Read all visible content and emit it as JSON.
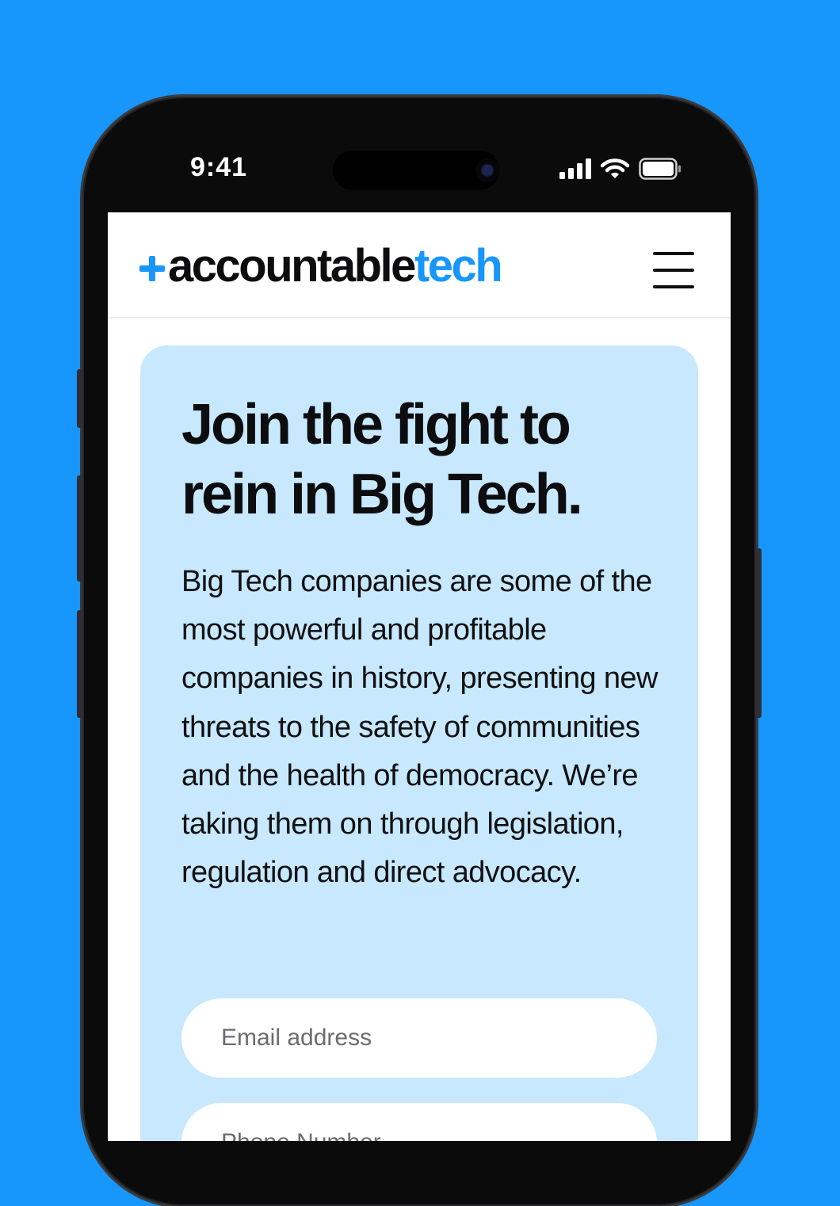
{
  "status_bar": {
    "time": "9:41",
    "icons": [
      "cellular-signal-icon",
      "wifi-icon",
      "battery-icon"
    ]
  },
  "header": {
    "logo": {
      "text_dark": "accountable",
      "text_accent": "tech",
      "mark": "plus-icon"
    },
    "menu_icon": "hamburger-menu-icon"
  },
  "hero": {
    "title_line1": "Join the fight to",
    "title_line2": "rein in Big Tech.",
    "body": "Big Tech companies are some of the most powerful and profitable companies in history, presenting new threats to the safety of communities and the health of democracy. We’re taking them on through legislation, regulation and direct advocacy.",
    "form": {
      "email_placeholder": "Email address",
      "phone_placeholder": "Phone Number"
    }
  },
  "colors": {
    "background": "#1796fc",
    "brand_blue": "#1796fc",
    "card": "#c7e8fd",
    "text": "#0d0d0f"
  }
}
